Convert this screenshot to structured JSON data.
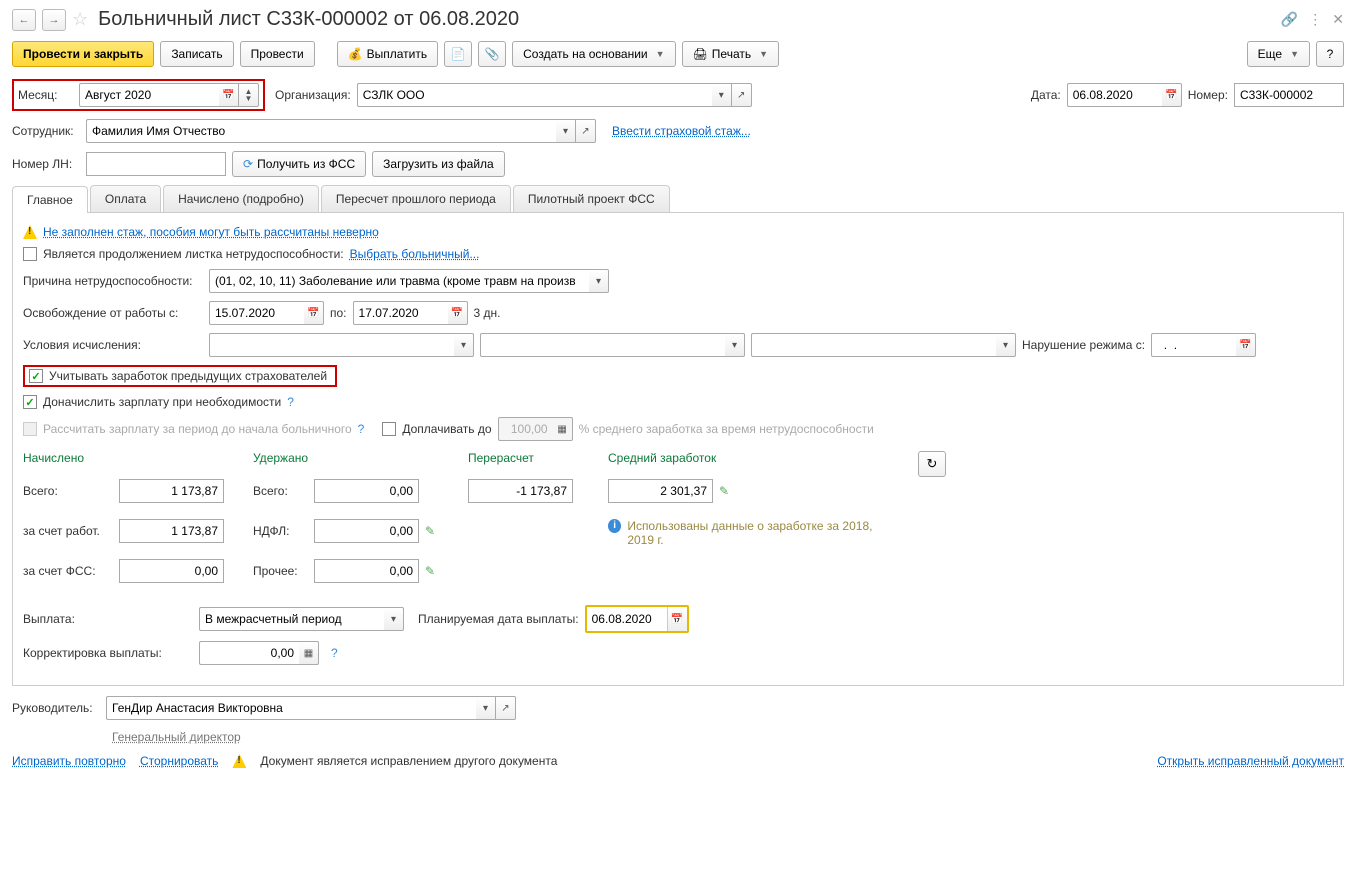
{
  "header": {
    "title": "Больничный лист С33К-000002 от 06.08.2020"
  },
  "toolbar": {
    "post_close": "Провести и закрыть",
    "save": "Записать",
    "post": "Провести",
    "pay": "Выплатить",
    "create_based": "Создать на основании",
    "print": "Печать",
    "more": "Еще"
  },
  "form": {
    "month_label": "Месяц:",
    "month_value": "Август 2020",
    "org_label": "Организация:",
    "org_value": "СЗЛК ООО",
    "date_label": "Дата:",
    "date_value": "06.08.2020",
    "number_label": "Номер:",
    "number_value": "С33К-000002",
    "employee_label": "Сотрудник:",
    "employee_value": "Фамилия Имя Отчество",
    "enter_stazh": "Ввести страховой стаж...",
    "ln_label": "Номер ЛН:",
    "get_fss": "Получить из ФСС",
    "load_file": "Загрузить из файла"
  },
  "tabs": {
    "main": "Главное",
    "payment": "Оплата",
    "accrued": "Начислено (подробно)",
    "recalc": "Пересчет прошлого периода",
    "pilot": "Пилотный проект ФСС"
  },
  "main_tab": {
    "stazh_warn": "Не заполнен стаж, пособия могут быть рассчитаны неверно",
    "continuation_label": "Является продолжением листка нетрудоспособности:",
    "select_ln": "Выбрать больничный...",
    "reason_label": "Причина нетрудоспособности:",
    "reason_value": "(01, 02, 10, 11) Заболевание или травма (кроме травм на произв",
    "release_label": "Освобождение от работы с:",
    "release_from": "15.07.2020",
    "release_to_label": "по:",
    "release_to": "17.07.2020",
    "days": "3 дн.",
    "conditions_label": "Условия исчисления:",
    "violation_label": "Нарушение режима с:",
    "violation_value": "  .  .    ",
    "prev_insurers": "Учитывать заработок предыдущих страхователей",
    "accrue_salary": "Доначислить зарплату при необходимости",
    "calc_salary_disabled": "Рассчитать зарплату за период до начала больничного",
    "pay_up_to": "Доплачивать до",
    "pay_up_value": "100,00",
    "pay_up_suffix": "% среднего заработка за время нетрудоспособности"
  },
  "totals": {
    "accrued_head": "Начислено",
    "withheld_head": "Удержано",
    "recalc_head": "Перерасчет",
    "avg_head": "Средний заработок",
    "total_label": "Всего:",
    "employer_label": "за счет работ.",
    "fss_label": "за счет ФСС:",
    "ndfl_label": "НДФЛ:",
    "other_label": "Прочее:",
    "accrued_total": "1 173,87",
    "accrued_employer": "1 173,87",
    "accrued_fss": "0,00",
    "withheld_total": "0,00",
    "withheld_ndfl": "0,00",
    "withheld_other": "0,00",
    "recalc_val": "-1 173,87",
    "avg_val": "2 301,37",
    "info_text": "Использованы данные о заработке за 2018,   2019 г.",
    "payout_label": "Выплата:",
    "payout_value": "В межрасчетный период",
    "planned_date_label": "Планируемая дата выплаты:",
    "planned_date": "06.08.2020",
    "correction_label": "Корректировка выплаты:",
    "correction_value": "0,00"
  },
  "footer": {
    "manager_label": "Руководитель:",
    "manager_value": "ГенДир Анастасия Викторовна",
    "manager_position": "Генеральный директор",
    "fix_again": "Исправить повторно",
    "storno": "Сторнировать",
    "correction_doc": "Документ является исправлением другого документа",
    "open_corrected": "Открыть исправленный документ"
  }
}
